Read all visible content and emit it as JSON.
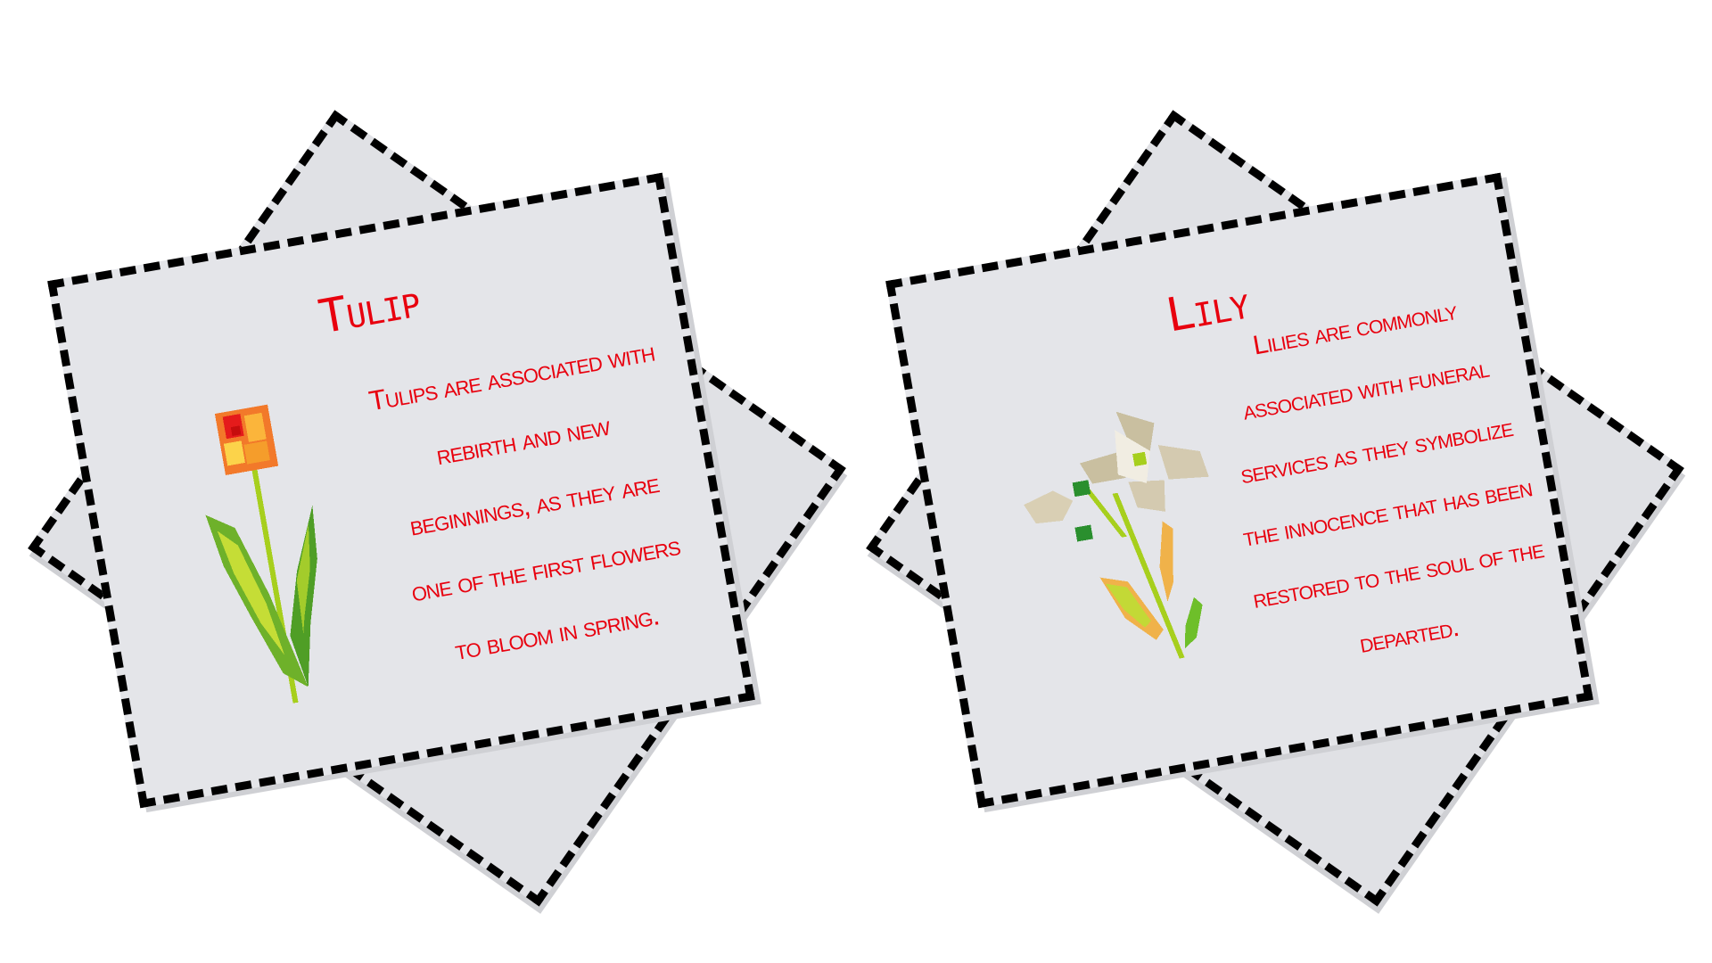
{
  "cards": {
    "tulip": {
      "title": "Tulip",
      "description": "Tulips are associated with rebirth and new beginnings, as they are one of the first flowers to bloom in spring.",
      "icon": "tulip-icon",
      "title_color": "#e8000e"
    },
    "lily": {
      "title": "Lily",
      "description": "Lilies are commonly associated with funeral services as they symbolize the innocence that has been restored to the soul of the departed.",
      "icon": "lily-icon",
      "title_color": "#e8000e"
    }
  },
  "colors": {
    "paper": "#e4e5e9",
    "outline": "#000000",
    "text": "#e8000e"
  }
}
